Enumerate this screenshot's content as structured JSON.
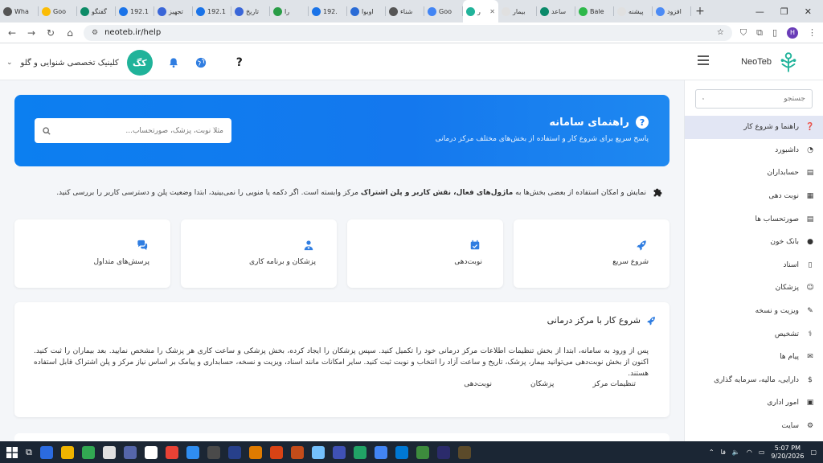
{
  "browser": {
    "tabs": [
      {
        "label": "افزود",
        "color": "#4c8bf5"
      },
      {
        "label": "پیشنه",
        "color": "#e0e0e0"
      },
      {
        "label": "Bale",
        "color": "#2eb84a"
      },
      {
        "label": "ساعد",
        "color": "#0b8a6a"
      },
      {
        "label": "بیمار",
        "color": "#e0e0e0"
      },
      {
        "label": "ر",
        "color": "#21b39a",
        "active": true
      },
      {
        "label": "Goo",
        "color": "#4285f4"
      },
      {
        "label": "شناء",
        "color": "#555555"
      },
      {
        "label": "اوبوا",
        "color": "#2a6bd6"
      },
      {
        "label": "192.",
        "color": "#1a73e8"
      },
      {
        "label": "را",
        "color": "#2a9d47"
      },
      {
        "label": "تاریخ",
        "color": "#3a66d8"
      },
      {
        "label": "192.1",
        "color": "#1a73e8"
      },
      {
        "label": "تجهیز",
        "color": "#3a66d8"
      },
      {
        "label": "192.1",
        "color": "#1a73e8"
      },
      {
        "label": "گفتگو",
        "color": "#0d8b67"
      },
      {
        "label": "Goo",
        "color": "#fbbc05"
      },
      {
        "label": "Wha",
        "color": "#555555"
      }
    ],
    "url": "neoteb.ir/help",
    "profile_initial": "H"
  },
  "header": {
    "logo_text": "NeoTeb",
    "clinic_name": "کلینیک تخصصی شنوایی و گلو",
    "avatar_initials": "کگ",
    "help_glyph": "?"
  },
  "sidebar": {
    "search_placeholder": "جستجو",
    "items": [
      {
        "label": "راهنما و شروع کار",
        "icon": "help-circle-icon",
        "glyph": "❓",
        "active": true
      },
      {
        "label": "داشبورد",
        "icon": "pie-chart-icon",
        "glyph": "◔"
      },
      {
        "label": "حسابداران",
        "icon": "document-icon",
        "glyph": "▤"
      },
      {
        "label": "نوبت دهی",
        "icon": "calendar-icon",
        "glyph": "▦"
      },
      {
        "label": "صورتحساب ها",
        "icon": "invoice-icon",
        "glyph": "▤"
      },
      {
        "label": "بانک خون",
        "icon": "drop-icon",
        "glyph": "●"
      },
      {
        "label": "اسناد",
        "icon": "file-icon",
        "glyph": "▯"
      },
      {
        "label": "پزشکان",
        "icon": "user-icon",
        "glyph": "☺"
      },
      {
        "label": "ویزیت و نسخه",
        "icon": "prescription-icon",
        "glyph": "✎"
      },
      {
        "label": "تشخیص",
        "icon": "stethoscope-icon",
        "glyph": "⚕"
      },
      {
        "label": "پیام ها",
        "icon": "chat-icon",
        "glyph": "✉"
      },
      {
        "label": "دارایی، مالیه، سرمایه گذاری",
        "icon": "wallet-icon",
        "glyph": "$"
      },
      {
        "label": "امور اداری",
        "icon": "briefcase-icon",
        "glyph": "▣"
      },
      {
        "label": "سایت",
        "icon": "gear-icon",
        "glyph": "⚙"
      }
    ]
  },
  "hero": {
    "title": "راهنمای سامانه",
    "subtitle": "پاسخ سریع برای شروع کار و استفاده از بخش‌های مختلف مرکز درمانی",
    "search_placeholder": "مثلاً نوبت، پزشک، صورتحساب..."
  },
  "notice": {
    "part1": "نمایش و امکان استفاده از بعضی بخش‌ها به",
    "bold": "ماژول‌های فعال، نقش کاربر و پلن اشتراک",
    "part2": "مرکز وابسته است. اگر دکمه یا منویی را نمی‌بینید، ابتدا وضعیت پلن و دسترسی کاربر را بررسی کنید."
  },
  "cards": [
    {
      "label": "شروع سریع",
      "icon": "rocket-icon"
    },
    {
      "label": "نوبت‌دهی",
      "icon": "calendar-icon"
    },
    {
      "label": "پزشکان و برنامه کاری",
      "icon": "doctor-icon"
    },
    {
      "label": "پرسش‌های متداول",
      "icon": "chat-icon"
    }
  ],
  "section": {
    "title": "شروع کار با مرکز درمانی",
    "text": "پس از ورود به سامانه، ابتدا از بخش تنظیمات اطلاعات مرکز درمانی خود را تکمیل کنید. سپس پزشکان را ایجاد کرده، بخش پزشکی و ساعت کاری هر پزشک را مشخص نمایید. بعد بیماران را ثبت کنید. اکنون از بخش نوبت‌دهی می‌توانید بیمار، پزشک، تاریخ و ساعت آزاد را انتخاب و نوبت ثبت کنید. سایر امکانات مانند اسناد، ویزیت و نسخه، حسابداری و پیامک بر اساس نیاز مرکز و پلن اشتراک قابل استفاده هستند.",
    "links": [
      "تنظیمات مرکز",
      "پزشکان",
      "نوبت‌دهی"
    ]
  },
  "colors": {
    "accent": "#1478ee",
    "teal": "#20b39a",
    "sidebar_active": "#e2e6f4"
  },
  "taskbar": {
    "time": "5:07 PM",
    "date": "9/20/2026",
    "lang": "فا",
    "icons": [
      "#2b6be0",
      "#f0b400",
      "#32a852",
      "#e0e0e0",
      "#5566aa",
      "#ffffff",
      "#e94235",
      "#2f8df0",
      "#4a4a4a",
      "#27408b",
      "#e07b00",
      "#d84315",
      "#c44c1a",
      "#74c0fc",
      "#3f51b5",
      "#21a366",
      "#4285f4",
      "#0078d4",
      "#3d8b3d",
      "#2b2b6b",
      "#5b4a2a"
    ]
  }
}
